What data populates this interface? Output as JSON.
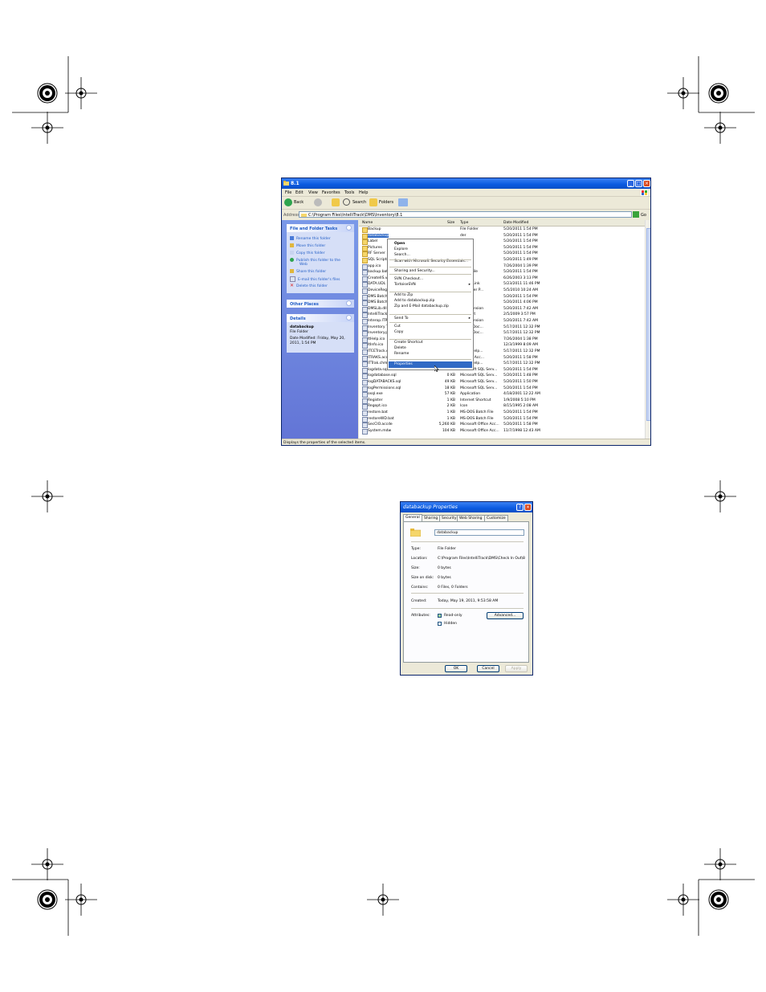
{
  "explorer": {
    "title": "8.1",
    "menu": [
      "File",
      "Edit",
      "View",
      "Favorites",
      "Tools",
      "Help"
    ],
    "toolbar": {
      "back": "Back",
      "search": "Search",
      "folders": "Folders"
    },
    "address": {
      "label": "Address",
      "path": "C:\\Program Files\\IntelliTrack\\DMS\\Inventory\\8.1",
      "go": "Go"
    },
    "file_tasks": {
      "title": "File and Folder Tasks",
      "items": [
        "Rename this folder",
        "Move this folder",
        "Copy this folder",
        "Publish this folder to the",
        "Web",
        "Share this folder",
        "E-mail this folder's files",
        "Delete this folder"
      ]
    },
    "other_places": {
      "title": "Other Places"
    },
    "details": {
      "title": "Details",
      "name": "databackup",
      "type": "File Folder",
      "modified_line1": "Date Modified: Friday, May 20,",
      "modified_line2": "2011, 1:54 PM"
    },
    "columns": {
      "name": "Name",
      "size": "Size",
      "type": "Type",
      "date": "Date Modified"
    },
    "files": [
      {
        "name": "Backup",
        "size": "",
        "type": "File Folder",
        "date": "5/20/2011 1:54 PM"
      },
      {
        "name": "databackup",
        "size": "",
        "type": "der",
        "date": "5/20/2011 1:54 PM"
      },
      {
        "name": "Label",
        "size": "",
        "type": "der",
        "date": "5/20/2011 1:54 PM"
      },
      {
        "name": "Pictures",
        "size": "",
        "type": "der",
        "date": "5/20/2011 1:54 PM"
      },
      {
        "name": "RF Server",
        "size": "",
        "type": "der",
        "date": "5/20/2011 1:54 PM"
      },
      {
        "name": "SQL Scripts",
        "size": "",
        "type": "der",
        "date": "5/20/2011 1:49 PM"
      },
      {
        "name": "app.ico",
        "size": "",
        "type": "",
        "date": "7/26/2004 1:39 PM"
      },
      {
        "name": "backup.bat",
        "size": "",
        "type": "Batch File",
        "date": "5/20/2011 1:54 PM"
      },
      {
        "name": "CreateIIS.vb",
        "size": "",
        "type": "on",
        "date": "6/26/2003 3:13 PM"
      },
      {
        "name": "DATA.UDL",
        "size": "",
        "type": "t Data Link",
        "date": "5/23/2011 11:46 PM"
      },
      {
        "name": "DeviceRegist",
        "size": "",
        "type": "t Installer P...",
        "date": "5/5/2010 10:24 AM"
      },
      {
        "name": "DMS Batch T",
        "size": "",
        "type": "on",
        "date": "5/20/2011 1:54 PM"
      },
      {
        "name": "DMS Batch T",
        "size": "",
        "type": "File",
        "date": "5/20/2011 4:06 PM"
      },
      {
        "name": "DMSLib.dll",
        "size": "",
        "type": "on Extension",
        "date": "5/20/2011 7:42 AM"
      },
      {
        "name": "IntelliTrack I",
        "size": "",
        "type": "Shortcut",
        "date": "2/5/2009 3:57 PM"
      },
      {
        "name": "Interop.ITR",
        "size": "",
        "type": "on Extension",
        "date": "5/20/2011 7:42 AM"
      },
      {
        "name": "Inventory To",
        "size": "",
        "type": "crobat Doc...",
        "date": "5/17/2011 12:32 PM"
      },
      {
        "name": "Inventory.pd",
        "size": "",
        "type": "crobat Doc...",
        "date": "5/17/2011 12:32 PM"
      },
      {
        "name": "ItHelp.ico",
        "size": "",
        "type": "",
        "date": "7/26/2004 1:38 PM"
      },
      {
        "name": "ItInfo.ico",
        "size": "",
        "type": "",
        "date": "12/3/1999 8:09 AM"
      },
      {
        "name": "ITCETrack.ch",
        "size": "",
        "type": "HTML Help...",
        "date": "5/17/2011 12:32 PM"
      },
      {
        "name": "ITRAKS.acc",
        "size": "",
        "type": "t Office Acc...",
        "date": "5/20/2011 1:58 PM"
      },
      {
        "name": "ITTrak.chm",
        "size": "",
        "type": "HTML Help...",
        "date": "5/17/2011 12:32 PM"
      },
      {
        "name": "logdata.sql",
        "size": "104 KB",
        "type": "Microsoft SQL Serv...",
        "date": "5/20/2011 1:54 PM"
      },
      {
        "name": "logdatabase.sql",
        "size": "0 KB",
        "type": "Microsoft SQL Serv...",
        "date": "5/20/2011 1:48 PM"
      },
      {
        "name": "logDATABACKS.sql",
        "size": "49 KB",
        "type": "Microsoft SQL Serv...",
        "date": "5/20/2011 1:50 PM"
      },
      {
        "name": "logPermissions.sql",
        "size": "18 KB",
        "type": "Microsoft SQL Serv...",
        "date": "5/20/2011 1:54 PM"
      },
      {
        "name": "osql.exe",
        "size": "57 KB",
        "type": "Application",
        "date": "4/18/2001 12:22 AM"
      },
      {
        "name": "Register",
        "size": "1 KB",
        "type": "Internet Shortcut",
        "date": "1/9/2008 5:10 PM"
      },
      {
        "name": "Regopt.ico",
        "size": "2 KB",
        "type": "Icon",
        "date": "8/15/1995 2:08 AM"
      },
      {
        "name": "restore.bat",
        "size": "1 KB",
        "type": "MS-DOS Batch File",
        "date": "5/20/2011 1:54 PM"
      },
      {
        "name": "restoreWD.bat",
        "size": "1 KB",
        "type": "MS-DOS Batch File",
        "date": "5/20/2011 1:54 PM"
      },
      {
        "name": "SecCIO.accde",
        "size": "5,260 KB",
        "type": "Microsoft Office Acc...",
        "date": "5/20/2011 1:58 PM"
      },
      {
        "name": "System.mdw",
        "size": "104 KB",
        "type": "Microsoft Office Acc...",
        "date": "11/7/1998 12:43 AM"
      }
    ],
    "context_menu": [
      {
        "label": "Open",
        "bold": true
      },
      {
        "label": "Explore"
      },
      {
        "label": "Search..."
      },
      {
        "label": "Scan with Microsoft Security Essentials..."
      },
      {
        "label": "Sharing and Security..."
      },
      {
        "label": "SVN Checkout..."
      },
      {
        "label": "TortoiseSVN"
      },
      {
        "label": "Add to Zip"
      },
      {
        "label": "Add to databackup.zip"
      },
      {
        "label": "Zip and E-Mail databackup.zip"
      },
      {
        "label": "Send To"
      },
      {
        "label": "Cut"
      },
      {
        "label": "Copy"
      },
      {
        "label": "Create Shortcut"
      },
      {
        "label": "Delete"
      },
      {
        "label": "Rename"
      },
      {
        "label": "Properties"
      }
    ],
    "status": "Displays the properties of the selected items."
  },
  "properties": {
    "title": "databackup Properties",
    "tabs": [
      "General",
      "Sharing",
      "Security",
      "Web Sharing",
      "Customize"
    ],
    "name": "databackup",
    "fields": [
      {
        "label": "Type:",
        "value": "File Folder"
      },
      {
        "label": "Location:",
        "value": "C:\\Program Files\\IntelliTrack\\DMS\\Check In Out\\8"
      },
      {
        "label": "Size:",
        "value": "0 bytes"
      },
      {
        "label": "Size on disk:",
        "value": "0 bytes"
      },
      {
        "label": "Contains:",
        "value": "0 Files, 0 Folders"
      }
    ],
    "created": {
      "label": "Created:",
      "value": "Today, May 19, 2011, 9:53:58 AM"
    },
    "attributes": {
      "label": "Attributes:",
      "readonly": "Read-only",
      "hidden": "Hidden",
      "advanced": "Advanced..."
    },
    "buttons": {
      "ok": "OK",
      "cancel": "Cancel",
      "apply": "Apply"
    }
  }
}
